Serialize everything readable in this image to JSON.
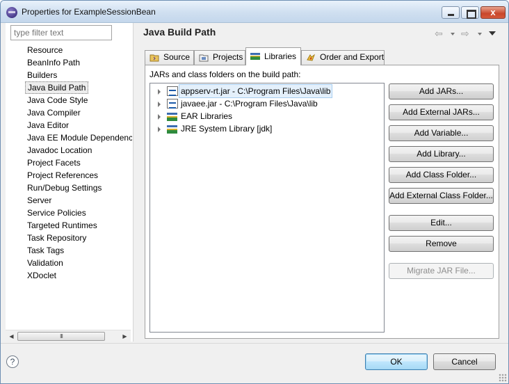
{
  "window": {
    "title": "Properties for ExampleSessionBean",
    "close_glyph": "x"
  },
  "sidebar": {
    "filter_placeholder": "type filter text",
    "items": [
      {
        "label": "Resource"
      },
      {
        "label": "BeanInfo Path"
      },
      {
        "label": "Builders"
      },
      {
        "label": "Java Build Path",
        "selected": true
      },
      {
        "label": "Java Code Style"
      },
      {
        "label": "Java Compiler"
      },
      {
        "label": "Java Editor"
      },
      {
        "label": "Java EE Module Dependencies"
      },
      {
        "label": "Javadoc Location"
      },
      {
        "label": "Project Facets"
      },
      {
        "label": "Project References"
      },
      {
        "label": "Run/Debug Settings"
      },
      {
        "label": "Server"
      },
      {
        "label": "Service Policies"
      },
      {
        "label": "Targeted Runtimes"
      },
      {
        "label": "Task Repository"
      },
      {
        "label": "Task Tags"
      },
      {
        "label": "Validation"
      },
      {
        "label": "XDoclet"
      }
    ],
    "scroll_thumb_grip": "III"
  },
  "page": {
    "title": "Java Build Path"
  },
  "tabs": [
    {
      "label": "Source",
      "icon": "source-folder-icon"
    },
    {
      "label": "Projects",
      "icon": "projects-icon"
    },
    {
      "label": "Libraries",
      "icon": "libraries-icon",
      "active": true
    },
    {
      "label": "Order and Export",
      "icon": "order-export-icon"
    }
  ],
  "libraries": {
    "label": "JARs and class folders on the build path:",
    "entries": [
      {
        "label": "appserv-rt.jar - C:\\Program Files\\Java\\lib",
        "icon": "jar-icon",
        "selected": true
      },
      {
        "label": "javaee.jar - C:\\Program Files\\Java\\lib",
        "icon": "jar-icon"
      },
      {
        "label": "EAR Libraries",
        "icon": "library-icon"
      },
      {
        "label": "JRE System Library [jdk]",
        "icon": "library-icon"
      }
    ]
  },
  "buttons": {
    "add_jars": "Add JARs...",
    "add_external_jars": "Add External JARs...",
    "add_variable": "Add Variable...",
    "add_library": "Add Library...",
    "add_class_folder": "Add Class Folder...",
    "add_external_class_folder": "Add External Class Folder...",
    "edit": "Edit...",
    "remove": "Remove",
    "migrate_jar": "Migrate JAR File..."
  },
  "footer": {
    "help": "?",
    "ok": "OK",
    "cancel": "Cancel"
  },
  "colors": {
    "accent": "#3c7fb1",
    "selection": "#e4f0fb"
  }
}
